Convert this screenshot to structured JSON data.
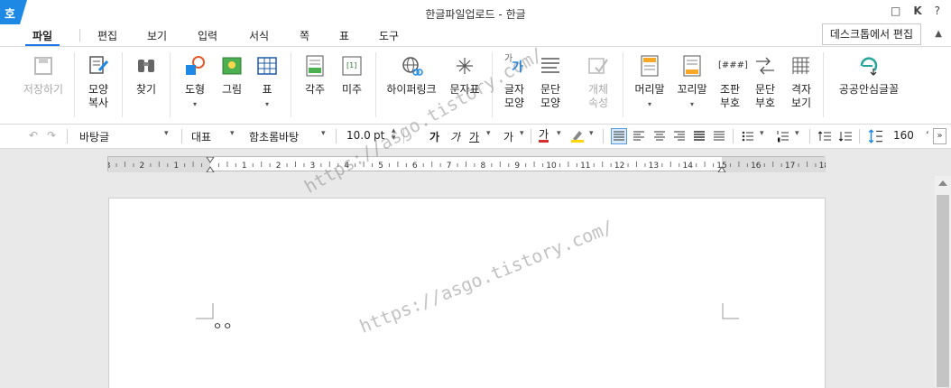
{
  "titlebar": {
    "app_icon_text": "호",
    "title": "한글파일업로드 - 한글",
    "controls": [
      "□",
      "K",
      "?"
    ]
  },
  "menubar": {
    "items": [
      "파일",
      "편집",
      "보기",
      "입력",
      "서식",
      "쪽",
      "표",
      "도구"
    ],
    "desktop_edit": "데스크톱에서 편집"
  },
  "ribbon": {
    "save": "저장하기",
    "shape_copy": [
      "모양",
      "복사"
    ],
    "find": "찾기",
    "shape": "도형",
    "picture": "그림",
    "table": "표",
    "footnote": "각주",
    "endnote": "미주",
    "hyperlink": "하이퍼링크",
    "symbol": "문자표",
    "char_shape": [
      "글자",
      "모양"
    ],
    "para_shape": [
      "문단",
      "모양"
    ],
    "obj_prop": [
      "개체",
      "속성"
    ],
    "header": "머리말",
    "footer": "꼬리말",
    "page_number": [
      "조판",
      "부호"
    ],
    "para_mark": [
      "문단",
      "부호"
    ],
    "grid_view": [
      "격자",
      "보기"
    ],
    "public_font": "공공안심글꼴",
    "page_number_icon": "[###]",
    "footnote_icon": "1)",
    "endnote_icon": "[1]",
    "char_icon_top": "가",
    "char_icon_bottom": "가"
  },
  "fmtbar": {
    "undo": "↶",
    "redo": "↷",
    "style": "바탕글",
    "lang": "대표",
    "font": "함초롬바탕",
    "size": "10.0",
    "unit": "pt",
    "bold": "가",
    "italic": "가",
    "underline": "가",
    "strike": "가",
    "font_color": "가",
    "line_spacing": "160"
  },
  "ruler": {
    "labels": [
      "3",
      "2",
      "1",
      "1",
      "2",
      "3",
      "4",
      "5",
      "6",
      "7",
      "8",
      "9",
      "10",
      "11",
      "12",
      "13",
      "14",
      "15",
      "16",
      "17",
      "18"
    ]
  },
  "document": {
    "mark": "ㅇㅇ"
  },
  "watermark": "https://asgo.tistory.com/",
  "colors": {
    "accent": "#1a73e8",
    "app_icon_bg": "#1e88e5"
  }
}
